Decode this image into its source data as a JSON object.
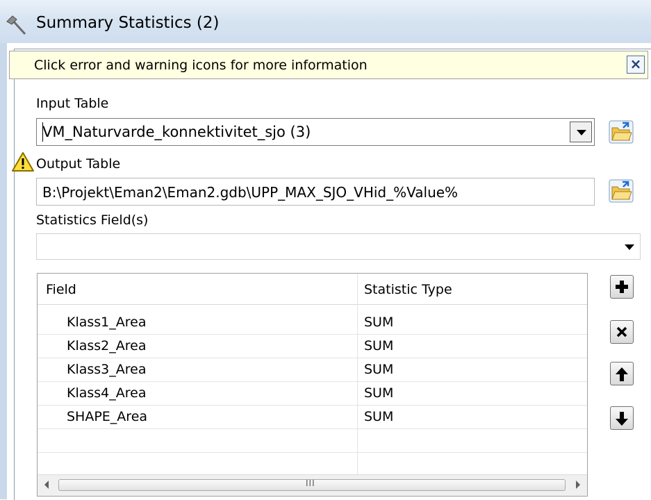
{
  "window": {
    "title": "Summary Statistics (2)",
    "title_icon": "hammer-icon"
  },
  "infobar": {
    "message": "Click error and warning icons for more information",
    "close_icon": "close-icon"
  },
  "input_table": {
    "label": "Input Table",
    "value": "VM_Naturvarde_konnektivitet_sjo (3)",
    "browse_icon": "folder-open-icon"
  },
  "output_table": {
    "label": "Output Table",
    "value": "B:\\Projekt\\Eman2\\Eman2.gdb\\UPP_MAX_SJO_VHid_%Value%",
    "status_icon": "warning-icon",
    "browse_icon": "folder-open-icon"
  },
  "statistics_field": {
    "label": "Statistics Field(s)",
    "value": ""
  },
  "stats_table": {
    "headers": [
      "Field",
      "Statistic Type"
    ],
    "rows": [
      {
        "field": "Klass1_Area",
        "type": "SUM"
      },
      {
        "field": "Klass2_Area",
        "type": "SUM"
      },
      {
        "field": "Klass3_Area",
        "type": "SUM"
      },
      {
        "field": "Klass4_Area",
        "type": "SUM"
      },
      {
        "field": "SHAPE_Area",
        "type": "SUM"
      }
    ],
    "scroll_grip": "III"
  },
  "side_buttons": [
    "add-icon",
    "remove-icon",
    "move-up-icon",
    "move-down-icon"
  ]
}
